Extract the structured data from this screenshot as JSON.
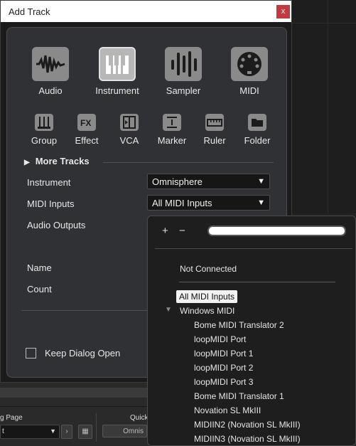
{
  "dialog": {
    "title": "Add Track",
    "close_label": "x"
  },
  "track_types_main": [
    {
      "label": "Audio",
      "icon": "waveform-icon"
    },
    {
      "label": "Instrument",
      "icon": "piano-keys-icon",
      "selected": true
    },
    {
      "label": "Sampler",
      "icon": "sampler-bars-icon"
    },
    {
      "label": "MIDI",
      "icon": "midi-connector-icon"
    }
  ],
  "track_types_secondary": [
    {
      "label": "Group",
      "icon": "group-faders-icon"
    },
    {
      "label": "Effect",
      "icon": "fx-icon"
    },
    {
      "label": "VCA",
      "icon": "vca-icon"
    },
    {
      "label": "Marker",
      "icon": "marker-icon"
    },
    {
      "label": "Ruler",
      "icon": "ruler-icon"
    },
    {
      "label": "Folder",
      "icon": "folder-icon"
    }
  ],
  "more_tracks": {
    "arrow": "▶",
    "label": "More Tracks"
  },
  "fields": {
    "instrument": {
      "label": "Instrument",
      "value": "Omnisphere"
    },
    "midi_inputs": {
      "label": "MIDI Inputs",
      "value": "All MIDI Inputs"
    },
    "audio_outputs": {
      "label": "Audio Outputs"
    },
    "name": {
      "label": "Name"
    },
    "count": {
      "label": "Count"
    }
  },
  "dropdown_arrow": "▼",
  "keep_dialog_open": {
    "label": "Keep Dialog Open",
    "checked": false
  },
  "midi_popup": {
    "plus": "+",
    "minus": "−",
    "not_connected": "Not Connected",
    "selected_item": "All MIDI Inputs",
    "group_arrow": "▼",
    "group_label": "Windows MIDI",
    "ports": [
      "Bome MIDI Translator 2",
      "loopMIDI Port",
      "loopMIDI Port 1",
      "loopMIDI Port 2",
      "loopMIDI Port 3",
      "Bome MIDI Translator 1",
      "Novation SL MkIII",
      "MIDIIN2 (Novation SL MkIII)",
      "MIDIIN3 (Novation SL MkIII)"
    ]
  },
  "background": {
    "label_page": "g Page",
    "label_quick": "Quick",
    "select_value": "t",
    "select_arrow": "▼",
    "omnis": "Omnis"
  },
  "colors": {
    "panel": "#2f3134",
    "close": "#c4393f",
    "selected_bg": "#f2f2f2"
  }
}
